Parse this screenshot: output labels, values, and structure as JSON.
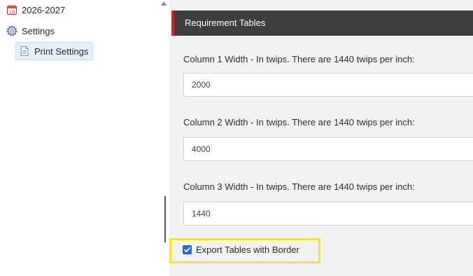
{
  "tree": {
    "items": [
      {
        "label": "2026-2027",
        "icon": "calendar-icon"
      },
      {
        "label": "Settings",
        "icon": "gear-icon"
      },
      {
        "label": "Print Settings",
        "icon": "document-icon",
        "selected": true
      }
    ]
  },
  "panel": {
    "header_title": "Requirement Tables",
    "fields": [
      {
        "label": "Column 1 Width - In twips. There are 1440 twips per inch:",
        "value": "2000"
      },
      {
        "label": "Column 2 Width - In twips. There are 1440 twips per inch:",
        "value": "4000"
      },
      {
        "label": "Column 3 Width - In twips. There are 1440 twips per inch:",
        "value": "1440"
      }
    ],
    "export_border": {
      "label": "Export Tables with Border",
      "checked": true
    }
  },
  "colors": {
    "header_bg": "#3d3d3d",
    "header_accent": "#c62828",
    "checkbox": "#1f6fd1",
    "highlight": "#f5e23a",
    "panel_bg": "#f2f2f2"
  }
}
